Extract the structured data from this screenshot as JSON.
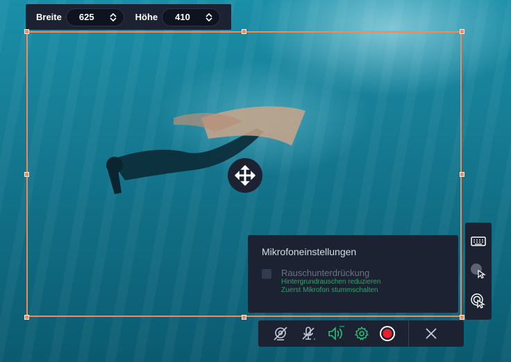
{
  "size_bar": {
    "width_label": "Breite",
    "width_value": "625",
    "height_label": "Höhe",
    "height_value": "410"
  },
  "mic_settings": {
    "title": "Mikrofoneinstellungen",
    "noise_suppression_label": "Rauschunterdrückung",
    "noise_suppression_checked": false,
    "hint_1": "Hintergrundrauschen reduzieren",
    "hint_2": "Zuerst Mikrofon stummschalten"
  },
  "side_toolbar": {
    "items": [
      "keyboard-icon",
      "cursor-highlight-icon",
      "click-effect-icon"
    ]
  },
  "bottom_toolbar": {
    "items": [
      "webcam-off-icon",
      "microphone-muted-icon",
      "system-audio-icon",
      "settings-icon",
      "record-icon",
      "close-icon"
    ]
  },
  "colors": {
    "accent": "#f28a5a",
    "panel": "#1d2232",
    "green": "#27c27a",
    "record": "#e8202a"
  }
}
